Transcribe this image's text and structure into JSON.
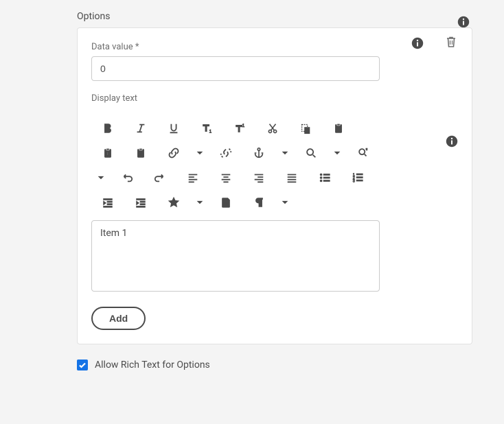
{
  "sectionTitle": "Options",
  "dataValueLabel": "Data value *",
  "dataValueValue": "0",
  "displayTextLabel": "Display text",
  "editorContent": "Item 1",
  "addLabel": "Add",
  "richTextLabel": "Allow Rich Text for Options",
  "richTextChecked": true
}
